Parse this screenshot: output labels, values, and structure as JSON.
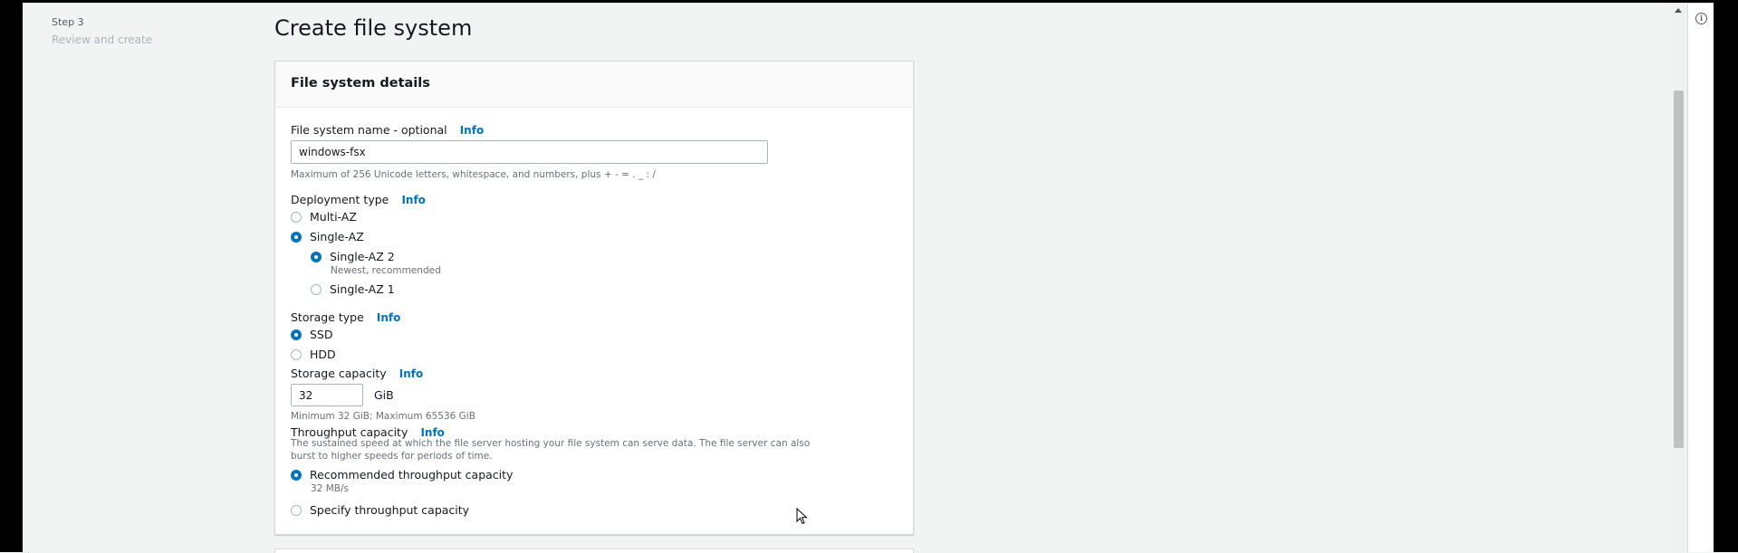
{
  "steps": {
    "step_number": "Step 3",
    "step_title": "Review and create"
  },
  "page_title": "Create file system",
  "panel": {
    "title": "File system details",
    "fs_name": {
      "label": "File system name - optional",
      "info": "Info",
      "value": "windows-fsx",
      "hint": "Maximum of 256 Unicode letters, whitespace, and numbers, plus + - = . _ : /"
    },
    "deployment": {
      "label": "Deployment type",
      "info": "Info",
      "options": {
        "multi_az": {
          "label": "Multi-AZ",
          "checked": false
        },
        "single_az": {
          "label": "Single-AZ",
          "checked": true
        },
        "single_az_2": {
          "label": "Single-AZ 2",
          "description": "Newest, recommended",
          "checked": true
        },
        "single_az_1": {
          "label": "Single-AZ 1",
          "checked": false
        }
      }
    },
    "storage_type": {
      "label": "Storage type",
      "info": "Info",
      "options": {
        "ssd": {
          "label": "SSD",
          "checked": true
        },
        "hdd": {
          "label": "HDD",
          "checked": false
        }
      }
    },
    "storage_capacity": {
      "label": "Storage capacity",
      "info": "Info",
      "value": "32",
      "unit": "GiB",
      "hint": "Minimum 32 GiB; Maximum 65536 GiB"
    },
    "throughput": {
      "label": "Throughput capacity",
      "info": "Info",
      "description_line1": "The sustained speed at which the file server hosting your file system can serve data. The file server can also",
      "description_line2": "burst to higher speeds for periods of time.",
      "options": {
        "recommended": {
          "label": "Recommended throughput capacity",
          "description": "32 MB/s",
          "checked": true
        },
        "specify": {
          "label": "Specify throughput capacity",
          "checked": false
        }
      }
    }
  },
  "icons": {
    "help_panel": "info-circle-icon",
    "scroll_up": "arrow-up-icon",
    "cursor": "mouse-pointer-icon"
  },
  "colors": {
    "accent": "#0073bb",
    "page_bg": "#f2f3f3",
    "panel_bg": "#ffffff",
    "text": "#16191f",
    "muted": "#687078"
  }
}
